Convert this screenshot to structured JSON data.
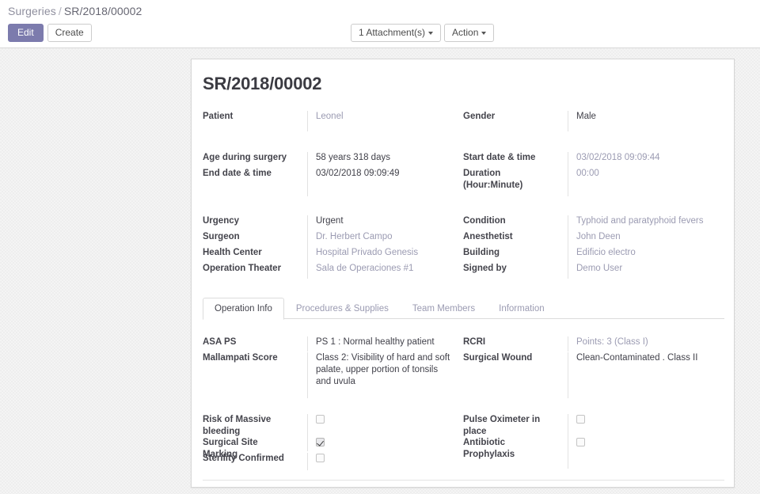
{
  "breadcrumb": {
    "root": "Surgeries",
    "separator": "/",
    "current": "SR/2018/00002"
  },
  "toolbar": {
    "edit_label": "Edit",
    "create_label": "Create",
    "attachments_label": "1 Attachment(s)",
    "action_label": "Action"
  },
  "record": {
    "title": "SR/2018/00002"
  },
  "colors": {
    "primary": "#7c7bad",
    "link": "#9b9bb2",
    "label": "#44444c"
  },
  "group1": {
    "left": [
      {
        "label": "Patient",
        "value": "Leonel",
        "style": "link"
      }
    ],
    "right": [
      {
        "label": "Gender",
        "value": "Male",
        "style": "plain"
      }
    ]
  },
  "group2": {
    "left": [
      {
        "label": "Age during surgery",
        "value": "58 years 318 days",
        "style": "plain"
      },
      {
        "label": "End date & time",
        "value": "03/02/2018 09:09:49",
        "style": "plain"
      }
    ],
    "right": [
      {
        "label": "Start date & time",
        "value": "03/02/2018 09:09:44",
        "style": "link"
      },
      {
        "label": "Duration (Hour:Minute)",
        "label_line1": "Duration",
        "label_line2": "(Hour:Minute)",
        "value": "00:00",
        "style": "link"
      }
    ]
  },
  "group3": {
    "left": [
      {
        "label": "Urgency",
        "value": "Urgent",
        "style": "plain"
      },
      {
        "label": "Surgeon",
        "value": "Dr. Herbert Campo",
        "style": "link"
      },
      {
        "label": "Health Center",
        "value": "Hospital Privado Genesis",
        "style": "link"
      },
      {
        "label": "Operation Theater",
        "value": "Sala de Operaciones #1",
        "style": "link"
      }
    ],
    "right": [
      {
        "label": "Condition",
        "value": "Typhoid and paratyphoid fevers",
        "style": "link"
      },
      {
        "label": "Anesthetist",
        "value": "John Deen",
        "style": "link"
      },
      {
        "label": "Building",
        "value": "Edificio electro",
        "style": "link"
      },
      {
        "label": "Signed by",
        "value": "Demo User",
        "style": "link"
      }
    ]
  },
  "notebook": {
    "tabs": [
      {
        "label": "Operation Info",
        "active": true
      },
      {
        "label": "Procedures & Supplies",
        "active": false
      },
      {
        "label": "Team Members",
        "active": false
      },
      {
        "label": "Information",
        "active": false
      }
    ]
  },
  "tab_operation_info": {
    "left": [
      {
        "label": "ASA PS",
        "value": "PS 1 : Normal healthy patient",
        "style": "plain"
      },
      {
        "label": "Mallampati Score",
        "value": "Class 2: Visibility of hard and soft palate, upper portion of tonsils and uvula",
        "style": "plain"
      }
    ],
    "right": [
      {
        "label": "RCRI",
        "value": "Points: 3 (Class I)",
        "style": "link"
      },
      {
        "label": "Surgical Wound",
        "value": "Clean-Contaminated . Class II",
        "style": "plain"
      }
    ],
    "checks_left": [
      {
        "label": "Risk of Massive bleeding",
        "checked": false
      },
      {
        "label": "Surgical Site Marking",
        "checked": true
      },
      {
        "label": "Sterility Confirmed",
        "checked": false
      }
    ],
    "checks_right": [
      {
        "label": "Pulse Oximeter in place",
        "checked": false
      },
      {
        "label": "Antibiotic Prophylaxis",
        "checked": false
      }
    ]
  }
}
